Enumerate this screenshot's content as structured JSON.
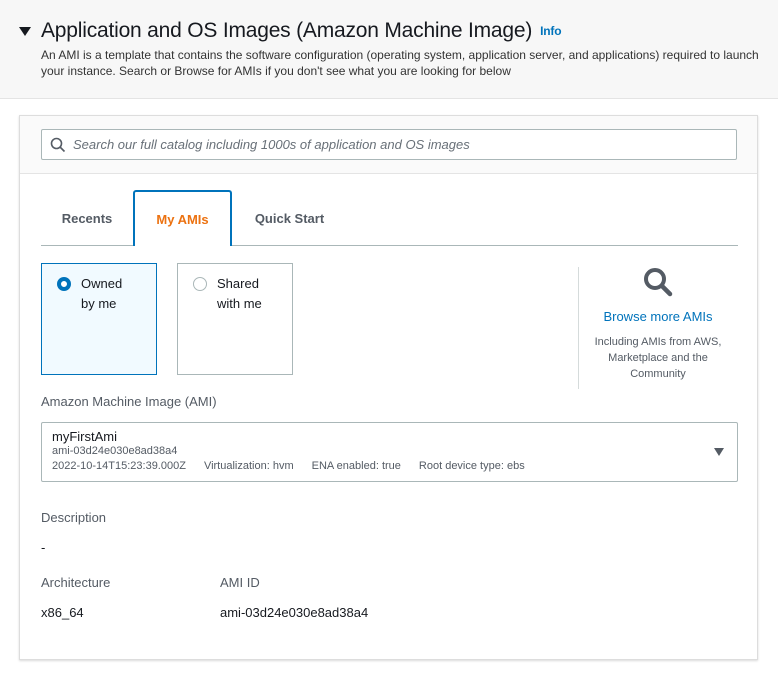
{
  "header": {
    "title": "Application and OS Images (Amazon Machine Image)",
    "info": "Info",
    "description": "An AMI is a template that contains the software configuration (operating system, application server, and applications) required to launch your instance. Search or Browse for AMIs if you don't see what you are looking for below"
  },
  "search": {
    "placeholder": "Search our full catalog including 1000s of application and OS images",
    "value": ""
  },
  "tabs": [
    {
      "label": "Recents"
    },
    {
      "label": "My AMIs",
      "active": true
    },
    {
      "label": "Quick Start"
    }
  ],
  "ownership": [
    {
      "label1": "Owned",
      "label2": "by me",
      "selected": true
    },
    {
      "label1": "Shared",
      "label2": "with me",
      "selected": false
    }
  ],
  "browse": {
    "link": "Browse more AMIs",
    "note": "Including AMIs from AWS, Marketplace and the Community"
  },
  "ami": {
    "label": "Amazon Machine Image (AMI)",
    "name": "myFirstAmi",
    "id": "ami-03d24e030e8ad38a4",
    "date": "2022-10-14T15:23:39.000Z",
    "virtualization": "Virtualization: hvm",
    "ena": "ENA enabled: true",
    "root": "Root device type: ebs"
  },
  "details": {
    "description_label": "Description",
    "description_value": "-",
    "architecture_label": "Architecture",
    "architecture_value": "x86_64",
    "ami_id_label": "AMI ID",
    "ami_id_value": "ami-03d24e030e8ad38a4"
  },
  "colors": {
    "accent": "#0073bb",
    "active_tab": "#ec7211"
  }
}
